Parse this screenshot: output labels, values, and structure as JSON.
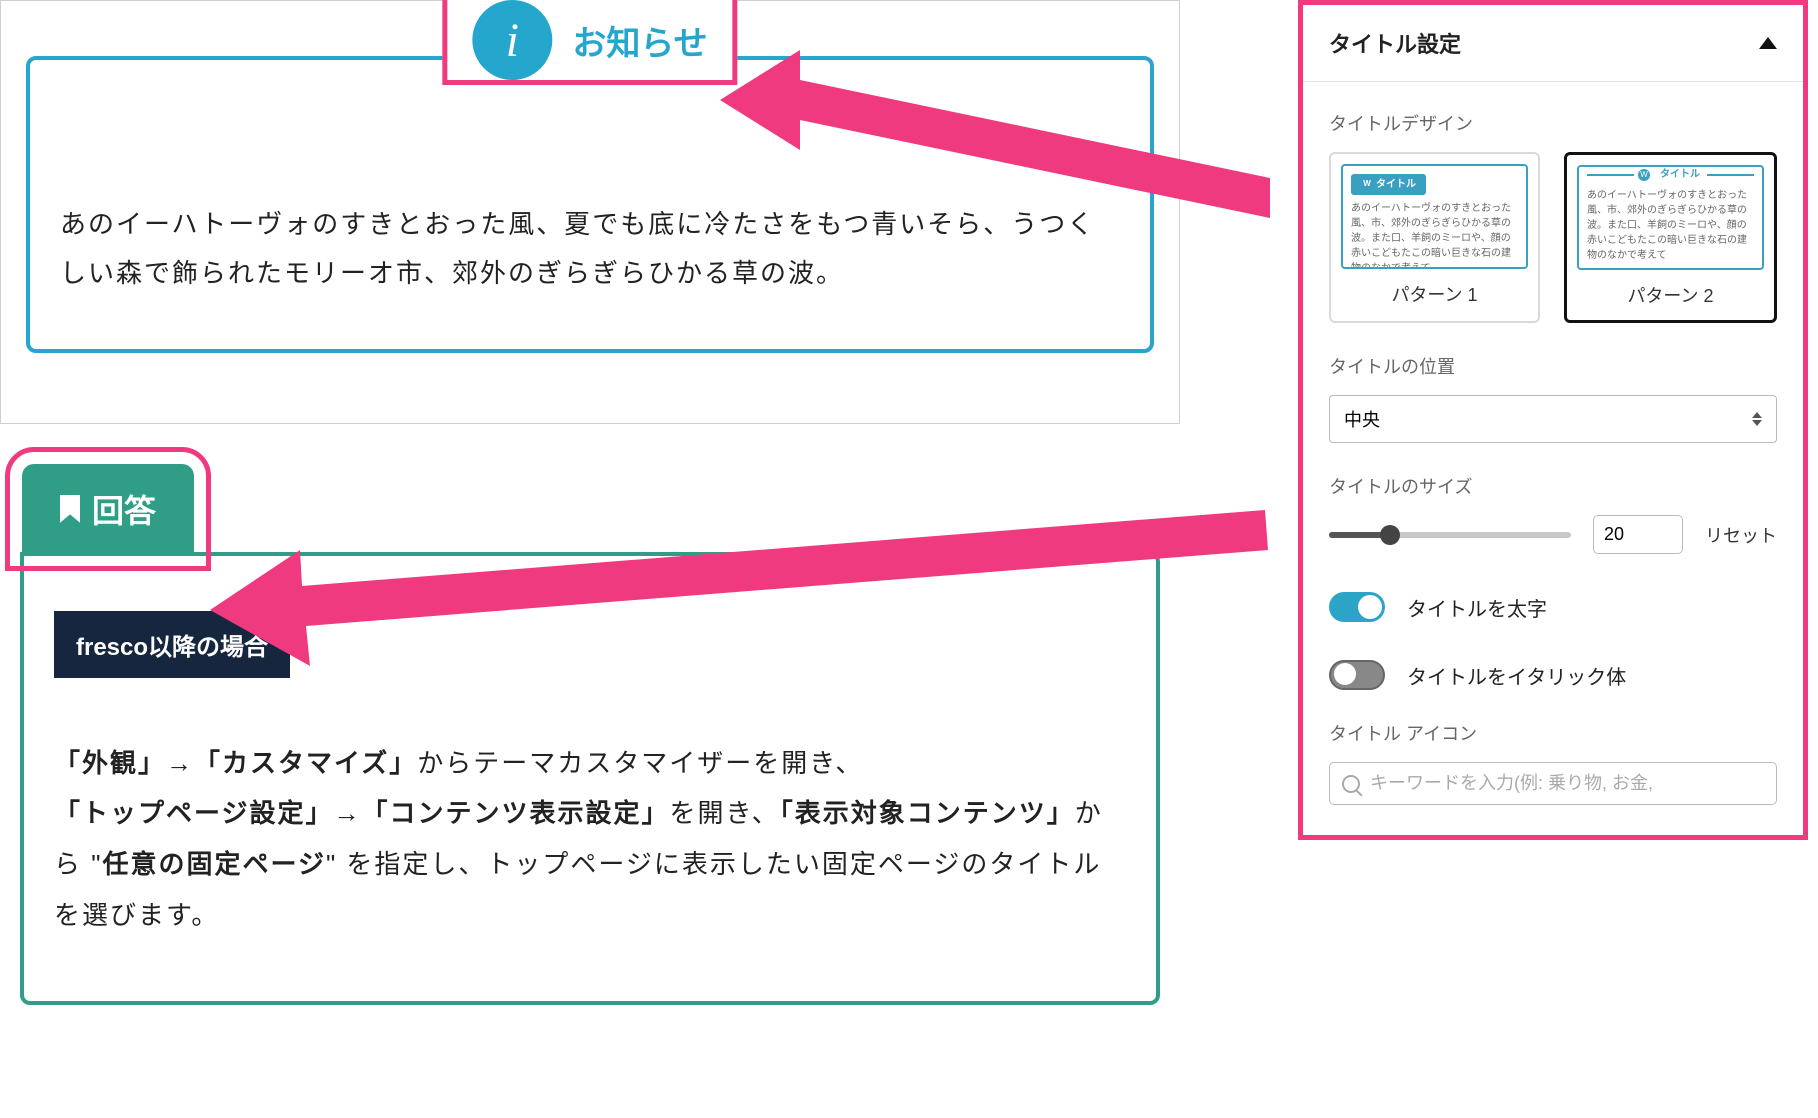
{
  "editor": {
    "notice": {
      "icon_char": "i",
      "title": "お知らせ",
      "body": "あのイーハトーヴォのすきとおった風、夏でも底に冷たさをもつ青いそら、うつくしい森で飾られたモリーオ市、郊外のぎらぎらひかる草の波。"
    },
    "answer": {
      "tab_label": "回答",
      "badge": "fresco以降の場合",
      "text_html": "<strong>「外観」</strong>→<strong>「カスタマイズ」</strong>からテーマカスタマイザーを開き、<strong>「トップページ設定」</strong>→<strong>「コンテンツ表示設定」</strong>を開き、<strong>「表示対象コンテンツ」</strong>から \"<strong>任意の固定ページ</strong>\" を指定し、トップページに表示したい固定ページのタイトルを選びます。"
    }
  },
  "sidebar": {
    "panel_title": "タイトル設定",
    "design": {
      "label": "タイトルデザイン",
      "preview_title": "タイトル",
      "preview_body": "あのイーハトーヴォのすきとおった風、市、郊外のぎらぎらひかる草の波。また口、羊飼のミーロや、顔の赤いこどもたこの暗い巨きな石の建物のなかで考えて",
      "patterns": [
        {
          "label": "パターン 1",
          "selected": false
        },
        {
          "label": "パターン 2",
          "selected": true
        }
      ]
    },
    "position": {
      "label": "タイトルの位置",
      "value": "中央"
    },
    "size": {
      "label": "タイトルのサイズ",
      "value": "20",
      "reset": "リセット"
    },
    "bold": {
      "label": "タイトルを太字",
      "on": true
    },
    "italic": {
      "label": "タイトルをイタリック体",
      "on": false
    },
    "icon": {
      "label": "タイトル アイコン",
      "placeholder": "キーワードを入力(例: 乗り物, お金,"
    }
  },
  "colors": {
    "annotation": "#ef3a7f",
    "notice_accent": "#25a6cd",
    "answer_accent": "#309e87",
    "toggle_on": "#2ba4c8"
  }
}
